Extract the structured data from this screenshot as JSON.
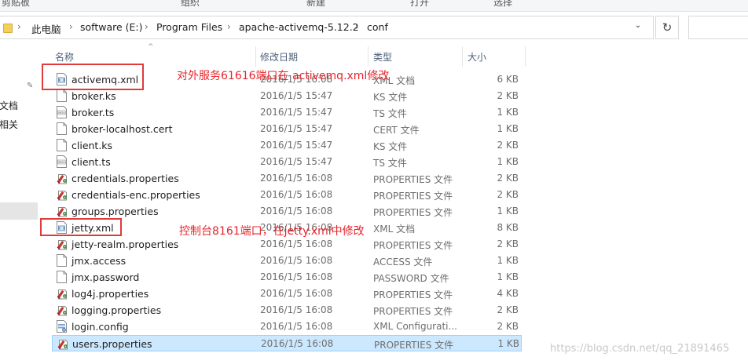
{
  "ribbon": {
    "labels": [
      "剪贴板",
      "组织",
      "新建",
      "打开",
      "选择"
    ]
  },
  "address": {
    "crumbs": [
      "此电脑",
      "software (E:)",
      "Program Files",
      "apache-activemq-5.12.2",
      "conf"
    ],
    "separator": "›",
    "dropdown": "⌄",
    "refresh": "↻"
  },
  "nav": {
    "items": [
      "文档",
      "相关"
    ],
    "pin": "✎"
  },
  "columns": {
    "name": "名称",
    "date": "修改日期",
    "type": "类型",
    "size": "大小",
    "sort": "^"
  },
  "files": [
    {
      "name": "activemq.xml",
      "date": "2016/1/5 16:08",
      "type": "XML 文档",
      "size": "6 KB",
      "icon": "xml-icon"
    },
    {
      "name": "broker.ks",
      "date": "2016/1/5 15:47",
      "type": "KS 文件",
      "size": "2 KB",
      "icon": "file-icon"
    },
    {
      "name": "broker.ts",
      "date": "2016/1/5 15:47",
      "type": "TS 文件",
      "size": "1 KB",
      "icon": "media-file-icon"
    },
    {
      "name": "broker-localhost.cert",
      "date": "2016/1/5 15:47",
      "type": "CERT 文件",
      "size": "1 KB",
      "icon": "file-icon"
    },
    {
      "name": "client.ks",
      "date": "2016/1/5 15:47",
      "type": "KS 文件",
      "size": "2 KB",
      "icon": "file-icon"
    },
    {
      "name": "client.ts",
      "date": "2016/1/5 15:47",
      "type": "TS 文件",
      "size": "1 KB",
      "icon": "media-file-icon"
    },
    {
      "name": "credentials.properties",
      "date": "2016/1/5 16:08",
      "type": "PROPERTIES 文件",
      "size": "2 KB",
      "icon": "properties-icon"
    },
    {
      "name": "credentials-enc.properties",
      "date": "2016/1/5 16:08",
      "type": "PROPERTIES 文件",
      "size": "2 KB",
      "icon": "properties-icon"
    },
    {
      "name": "groups.properties",
      "date": "2016/1/5 16:08",
      "type": "PROPERTIES 文件",
      "size": "1 KB",
      "icon": "properties-icon"
    },
    {
      "name": "jetty.xml",
      "date": "2016/1/5 16:08",
      "type": "XML 文档",
      "size": "8 KB",
      "icon": "xml-icon"
    },
    {
      "name": "jetty-realm.properties",
      "date": "2016/1/5 16:08",
      "type": "PROPERTIES 文件",
      "size": "2 KB",
      "icon": "properties-icon"
    },
    {
      "name": "jmx.access",
      "date": "2016/1/5 16:08",
      "type": "ACCESS 文件",
      "size": "1 KB",
      "icon": "file-icon"
    },
    {
      "name": "jmx.password",
      "date": "2016/1/5 16:08",
      "type": "PASSWORD 文件",
      "size": "1 KB",
      "icon": "file-icon"
    },
    {
      "name": "log4j.properties",
      "date": "2016/1/5 16:08",
      "type": "PROPERTIES 文件",
      "size": "4 KB",
      "icon": "properties-icon"
    },
    {
      "name": "logging.properties",
      "date": "2016/1/5 16:08",
      "type": "PROPERTIES 文件",
      "size": "2 KB",
      "icon": "properties-icon"
    },
    {
      "name": "login.config",
      "date": "2016/1/5 16:08",
      "type": "XML Configurati...",
      "size": "2 KB",
      "icon": "config-icon"
    },
    {
      "name": "users.properties",
      "date": "2016/1/5 16:08",
      "type": "PROPERTIES 文件",
      "size": "1 KB",
      "icon": "properties-icon",
      "selected": true
    }
  ],
  "annotations": {
    "note1": "对外服务61616端口在 activemq.xml修改",
    "note2": "控制台8161端口，在jetty.xml中修改"
  },
  "watermark": "https://blog.csdn.net/qq_21891465",
  "colors": {
    "selection": "#cce8ff",
    "annotation": "#e03a3a"
  }
}
